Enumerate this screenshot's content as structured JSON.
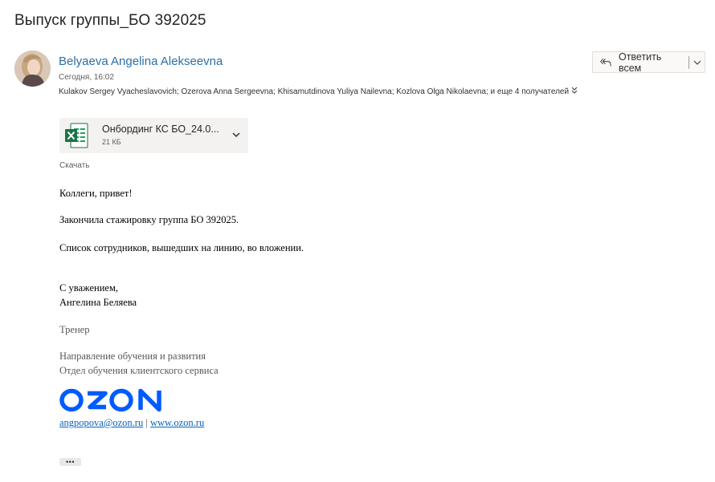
{
  "email": {
    "subject": "Выпуск группы_БО 392025",
    "sender_name": "Belyaeva Angelina Alekseevna",
    "date": "Сегодня, 16:02",
    "recipients": "Kulakov Sergey Vyacheslavovich; Ozerova Anna Sergeevna; Khisamutdinova Yuliya Nailevna; Kozlova Olga Nikolaevna; и еще 4 получателей",
    "reply_all_label": "Ответить всем"
  },
  "attachment": {
    "name": "Онбординг КС БО_24.0...",
    "size": "21 КБ",
    "icon": "excel-file-icon",
    "download_label": "Скачать"
  },
  "body": {
    "greeting": "Коллеги, привет!",
    "line1": "Закончила стажировку группа БО 392025.",
    "line2": "Список сотрудников, вышедших на линию, во вложении."
  },
  "signature": {
    "regards": "С уважением,",
    "name": "Ангелина Беляева",
    "role": "Тренер",
    "dept1": "Направление обучения и развития",
    "dept2": "Отдел обучения клиентского сервиса",
    "logo_text": "OZON",
    "email": "angpopova@ozon.ru",
    "separator": "|",
    "website": "www.ozon.ru"
  },
  "expand_label": "•••",
  "colors": {
    "sender": "#2b6fa8",
    "ozon_brand": "#005bff",
    "link": "#0563c1",
    "excel_green": "#1e7145"
  }
}
